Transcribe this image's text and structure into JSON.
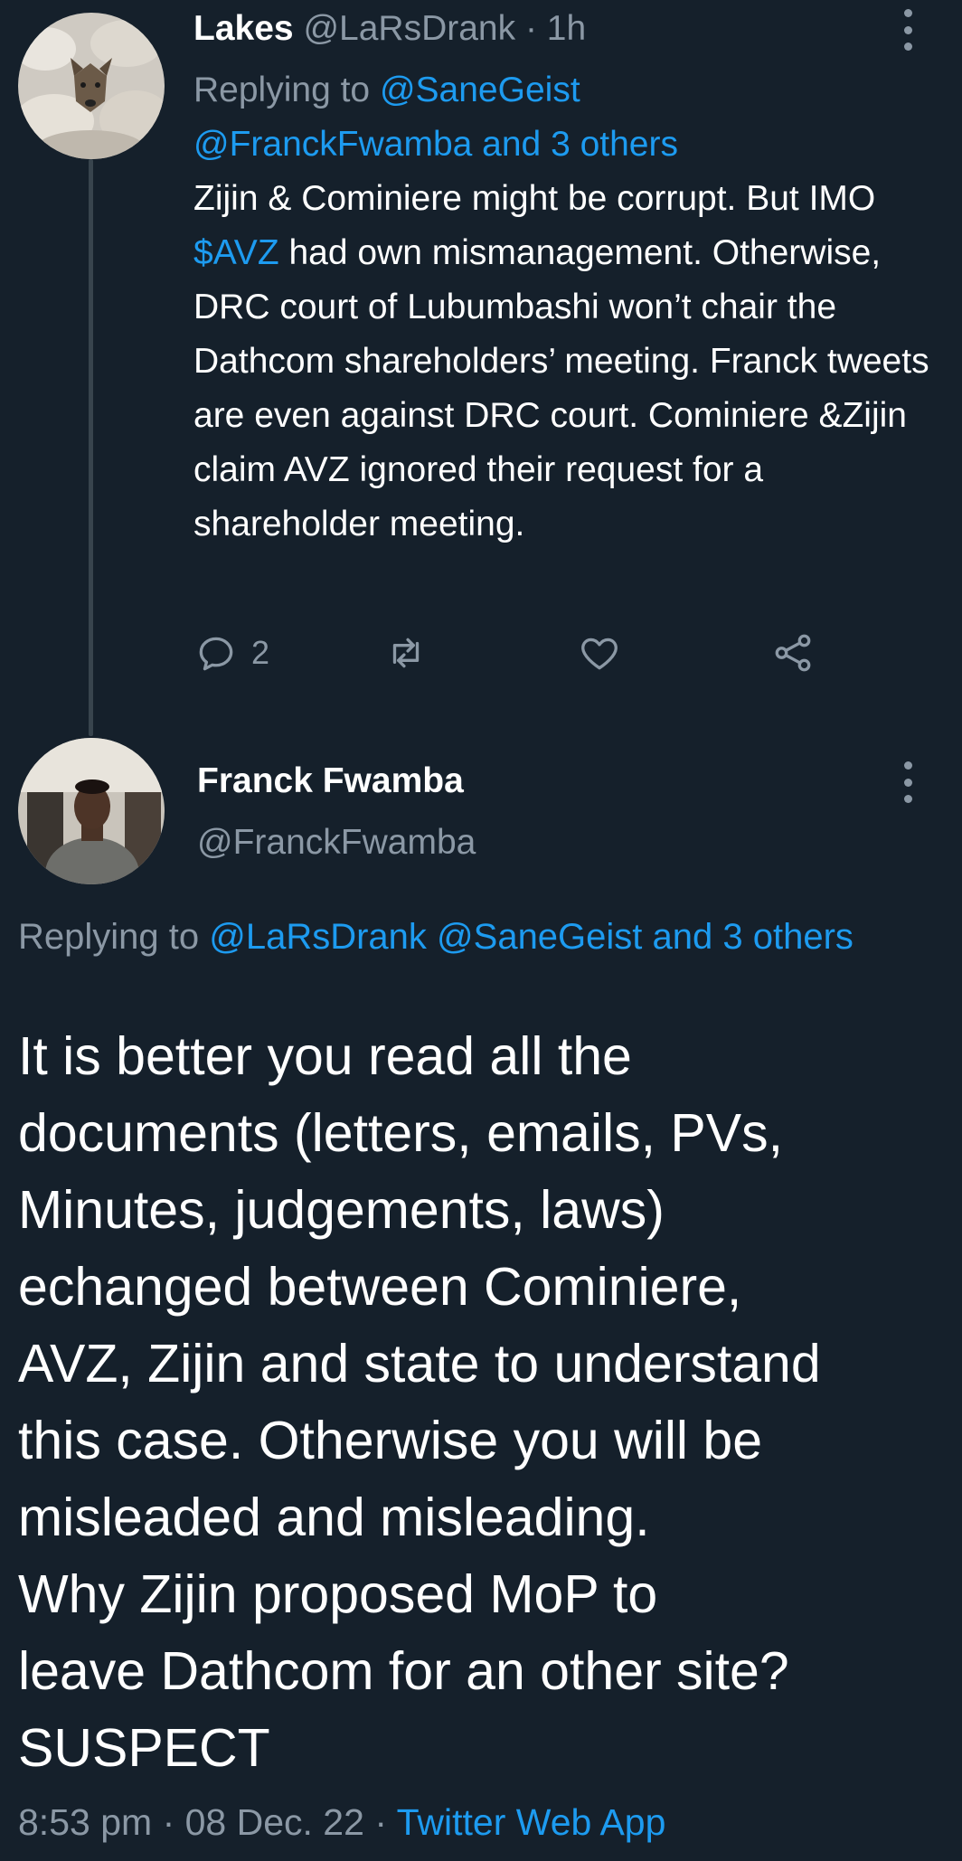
{
  "parent_tweet": {
    "display_name": "Lakes",
    "handle": "@LaRsDrank",
    "time": "1h",
    "replying_prefix": "Replying to ",
    "replying_to_line1": "@SaneGeist",
    "replying_to_line2": "@FranckFwamba and 3 others",
    "text_part1": "Zijin & Cominiere might be corrupt. But IMO ",
    "cashtag": "$AVZ",
    "text_part2": " had own mismanagement. Otherwise, DRC court of Lubumbashi won’t chair the Dathcom shareholders’ meeting. Franck tweets are even against DRC court. Cominiere &Zijin claim AVZ ignored their request for a shareholder meeting.",
    "reply_count": "2",
    "icons": {
      "reply": "reply-icon",
      "retweet": "retweet-icon",
      "like": "heart-icon",
      "share": "share-icon",
      "more": "more-vertical-icon"
    }
  },
  "main_tweet": {
    "display_name": "Franck Fwamba",
    "handle": "@FranckFwamba",
    "replying_prefix": "Replying to ",
    "replying_to": "@LaRsDrank @SaneGeist and 3 others",
    "lines": [
      "It is better you read all the",
      "documents (letters, emails, PVs,",
      "Minutes, judgements, laws)",
      "echanged between Cominiere,",
      "AVZ, Zijin and state to understand",
      "this case. Otherwise you will be",
      "misleaded and misleading.",
      "Why Zijin proposed MoP to",
      "leave Dathcom for an other site?",
      "SUSPECT"
    ],
    "time": "8:53 pm",
    "date": "08 Dec. 22",
    "source": "Twitter Web App"
  },
  "colors": {
    "background": "#15202b",
    "link": "#1d9bf0",
    "muted": "#8b98a5",
    "text": "#ffffff",
    "thread_line": "#38444d"
  }
}
